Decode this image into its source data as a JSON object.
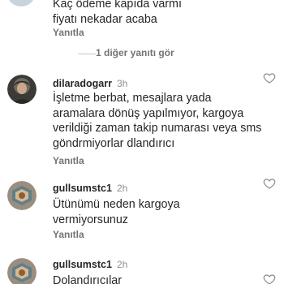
{
  "comments": [
    {
      "body_line1": "Kaç ödeme kapıda varmı",
      "body_line2": "fiyatı nekadar acaba",
      "reply_label": "Yanıtla"
    },
    {
      "more_replies": "1 diğer yanıtı gör"
    },
    {
      "username": "dilaradogarr",
      "time": "3h",
      "body": "İşletme berbat, mesajlara yada aramalara dönüş yapılmıyor, kargoya verildiği zaman takip numarası veya sms göndrmiyorlar dlandırıcı",
      "reply_label": "Yanıtla"
    },
    {
      "username": "gullsumstc1",
      "time": "2h",
      "body": "Ütünümü neden kargoya vermiyorsunuz",
      "reply_label": "Yanıtla"
    },
    {
      "username": "gullsumstc1",
      "time": "2h",
      "body": "Dolandırıcılar"
    }
  ],
  "icons": {
    "like": "heart-outline-icon"
  },
  "colors": {
    "primary_text": "#262626",
    "secondary_text": "#8e8e8e",
    "reply_text": "#737373"
  }
}
